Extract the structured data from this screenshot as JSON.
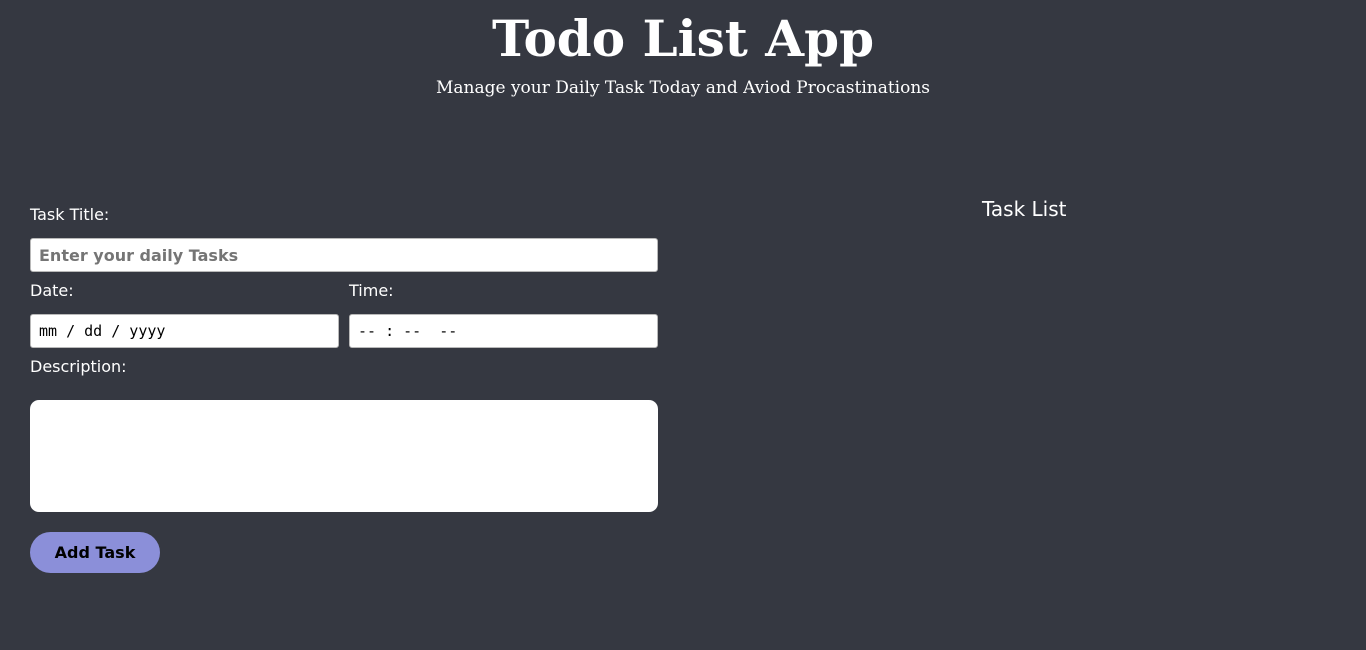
{
  "header": {
    "title": "Todo List App",
    "subtitle": "Manage your Daily Task Today and Aviod Procastinations"
  },
  "form": {
    "task_title_label": "Task Title:",
    "task_title_placeholder": "Enter your daily Tasks",
    "date_label": "Date:",
    "date_value": "mm / dd / yyyy",
    "time_label": "Time:",
    "time_value": "-- : --  --",
    "description_label": "Description:",
    "description_value": "",
    "add_button_label": "Add Task"
  },
  "task_list": {
    "heading": "Task List"
  },
  "colors": {
    "background": "#353841",
    "button": "#8b8fd9",
    "text": "#ffffff"
  }
}
